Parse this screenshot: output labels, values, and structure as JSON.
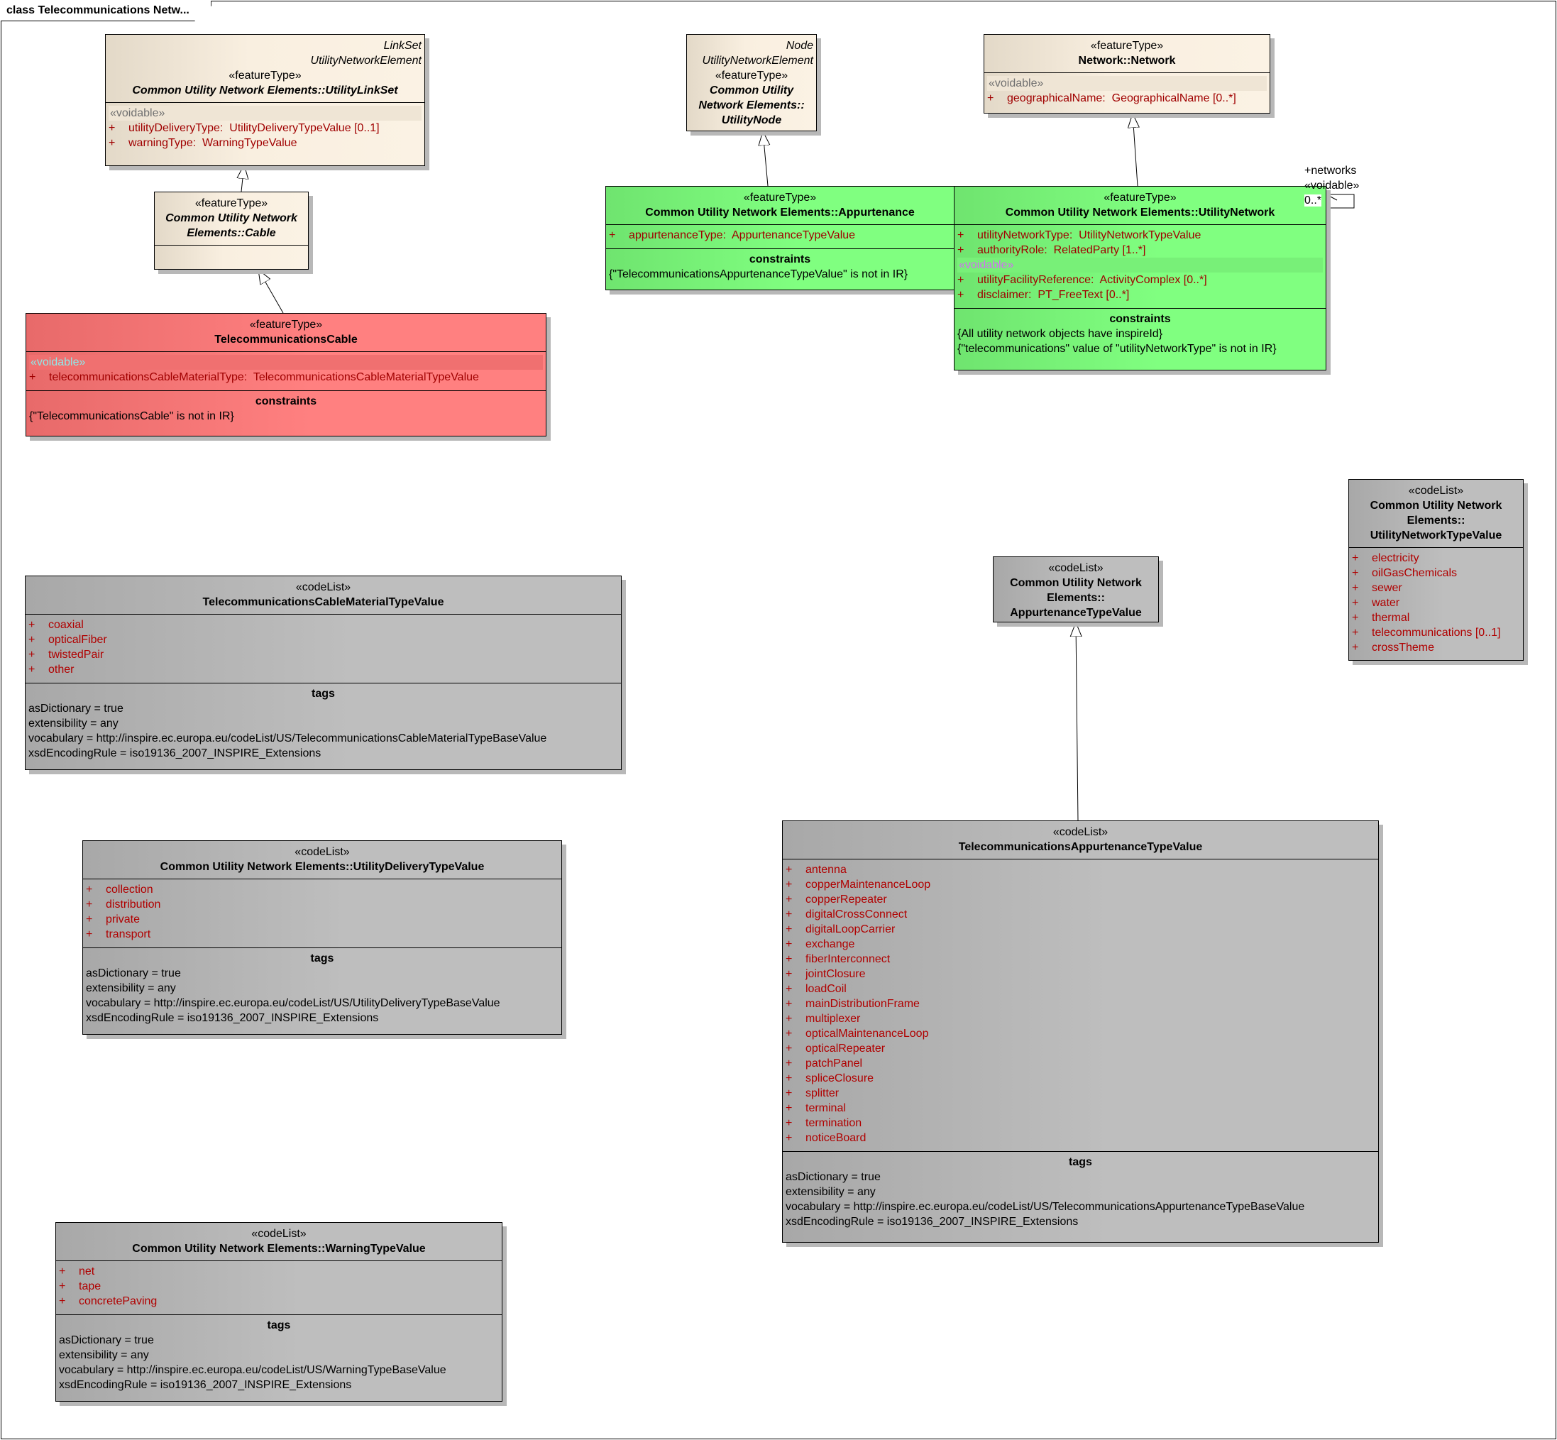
{
  "frame_title": "class Telecommunications Netw...",
  "association": {
    "role": "+networks",
    "stereotype": "«voidable»",
    "multiplicity": "0..*"
  },
  "classes": [
    {
      "id": "linkset",
      "theme": "beige",
      "above": [
        "LinkSet",
        "UtilityNetworkElement"
      ],
      "stereotype": "«featureType»",
      "name": "Common Utility Network Elements::UtilityLinkSet",
      "italic": true,
      "sections": [
        {
          "kind": "attrs",
          "stereo": "«voidable»",
          "items": [
            "utilityDeliveryType:  UtilityDeliveryTypeValue [0..1]",
            "warningType:  WarningTypeValue"
          ]
        }
      ]
    },
    {
      "id": "cable",
      "theme": "beige",
      "above": [],
      "stereotype": "«featureType»",
      "name": "Common Utility Network Elements::Cable",
      "italic": true,
      "sections": [
        {
          "kind": "attrs",
          "items": []
        }
      ]
    },
    {
      "id": "telecable",
      "theme": "red",
      "above": [],
      "stereotype": "«featureType»",
      "name": "TelecommunicationsCable",
      "italic": false,
      "sections": [
        {
          "kind": "attrs",
          "stereo": "«voidable»",
          "items": [
            "telecommunicationsCableMaterialType:  TelecommunicationsCableMaterialTypeValue"
          ]
        },
        {
          "kind": "text",
          "title": "constraints",
          "lines": [
            "{\"TelecommunicationsCable\" is not in IR}"
          ]
        }
      ]
    },
    {
      "id": "node",
      "theme": "beige",
      "above": [
        "Node",
        "UtilityNetworkElement"
      ],
      "stereotype": "«featureType»",
      "name": "Common Utility Network Elements:: UtilityNode",
      "italic": true,
      "sections": []
    },
    {
      "id": "network",
      "theme": "beige",
      "above": [],
      "stereotype": "«featureType»",
      "name": "Network::Network",
      "italic": false,
      "sections": [
        {
          "kind": "attrs",
          "stereo": "«voidable»",
          "items": [
            "geographicalName:  GeographicalName [0..*]"
          ]
        }
      ]
    },
    {
      "id": "appurtenance",
      "theme": "green",
      "above": [],
      "stereotype": "«featureType»",
      "name": "Common Utility Network Elements::Appurtenance",
      "italic": false,
      "sections": [
        {
          "kind": "attrs",
          "items": [
            "appurtenanceType:  AppurtenanceTypeValue"
          ]
        },
        {
          "kind": "text",
          "title": "constraints",
          "lines": [
            "{\"TelecommunicationsAppurtenanceTypeValue\" is not in IR}"
          ]
        }
      ]
    },
    {
      "id": "utilnetwork",
      "theme": "green",
      "above": [],
      "stereotype": "«featureType»",
      "name": "Common Utility Network Elements::UtilityNetwork",
      "italic": false,
      "sections": [
        {
          "kind": "attrs",
          "items": [
            "utilityNetworkType:  UtilityNetworkTypeValue",
            "authorityRole:  RelatedParty [1..*]"
          ],
          "stereo2": "«voidable»",
          "items2": [
            "utilityFacilityReference:  ActivityComplex [0..*]",
            "disclaimer:  PT_FreeText [0..*]"
          ]
        },
        {
          "kind": "text",
          "title": "constraints",
          "lines": [
            "{All utility network objects have inspireId}",
            "{\"telecommunications\" value of \"utilityNetworkType\" is not in IR}"
          ]
        }
      ]
    },
    {
      "id": "untv",
      "theme": "gray",
      "above": [],
      "stereotype": "«codeList»",
      "name": "Common Utility Network Elements:: UtilityNetworkTypeValue",
      "italic": false,
      "sections": [
        {
          "kind": "attrs",
          "items": [
            "electricity",
            "oilGasChemicals",
            "sewer",
            "water",
            "thermal",
            "telecommunications [0..1]",
            "crossTheme"
          ]
        }
      ]
    },
    {
      "id": "atv",
      "theme": "gray",
      "above": [],
      "stereotype": "«codeList»",
      "name": "Common Utility Network Elements:: AppurtenanceTypeValue",
      "italic": false,
      "sections": []
    },
    {
      "id": "tcmtv",
      "theme": "gray",
      "above": [],
      "stereotype": "«codeList»",
      "name": "TelecommunicationsCableMaterialTypeValue",
      "italic": false,
      "sections": [
        {
          "kind": "attrs",
          "items": [
            "coaxial",
            "opticalFiber",
            "twistedPair",
            "other"
          ]
        },
        {
          "kind": "text",
          "title": "tags",
          "lines": [
            "asDictionary = true",
            "extensibility = any",
            "vocabulary = http://inspire.ec.europa.eu/codeList/US/TelecommunicationsCableMaterialTypeBaseValue",
            "xsdEncodingRule = iso19136_2007_INSPIRE_Extensions"
          ]
        }
      ]
    },
    {
      "id": "udtv",
      "theme": "gray",
      "above": [],
      "stereotype": "«codeList»",
      "name": "Common Utility Network Elements::UtilityDeliveryTypeValue",
      "italic": false,
      "sections": [
        {
          "kind": "attrs",
          "items": [
            "collection",
            "distribution",
            "private",
            "transport"
          ]
        },
        {
          "kind": "text",
          "title": "tags",
          "lines": [
            "asDictionary = true",
            "extensibility = any",
            "vocabulary = http://inspire.ec.europa.eu/codeList/US/UtilityDeliveryTypeBaseValue",
            "xsdEncodingRule = iso19136_2007_INSPIRE_Extensions"
          ]
        }
      ]
    },
    {
      "id": "wtv",
      "theme": "gray",
      "above": [],
      "stereotype": "«codeList»",
      "name": "Common Utility Network Elements::WarningTypeValue",
      "italic": false,
      "sections": [
        {
          "kind": "attrs",
          "items": [
            "net",
            "tape",
            "concretePaving"
          ]
        },
        {
          "kind": "text",
          "title": "tags",
          "lines": [
            "asDictionary = true",
            "extensibility = any",
            "vocabulary = http://inspire.ec.europa.eu/codeList/US/WarningTypeBaseValue",
            "xsdEncodingRule = iso19136_2007_INSPIRE_Extensions"
          ]
        }
      ]
    },
    {
      "id": "tatv",
      "theme": "gray",
      "above": [],
      "stereotype": "«codeList»",
      "name": "TelecommunicationsAppurtenanceTypeValue",
      "italic": false,
      "sections": [
        {
          "kind": "attrs",
          "items": [
            "antenna",
            "copperMaintenanceLoop",
            "copperRepeater",
            "digitalCrossConnect",
            "digitalLoopCarrier",
            "exchange",
            "fiberInterconnect",
            "jointClosure",
            "loadCoil",
            "mainDistributionFrame",
            "multiplexer",
            "opticalMaintenanceLoop",
            "opticalRepeater",
            "patchPanel",
            "spliceClosure",
            "splitter",
            "terminal",
            "termination",
            "noticeBoard"
          ]
        },
        {
          "kind": "text",
          "title": "tags",
          "lines": [
            "asDictionary = true",
            "extensibility = any",
            "vocabulary = http://inspire.ec.europa.eu/codeList/US/TelecommunicationsAppurtenanceTypeBaseValue",
            "xsdEncodingRule = iso19136_2007_INSPIRE_Extensions"
          ]
        }
      ]
    }
  ]
}
